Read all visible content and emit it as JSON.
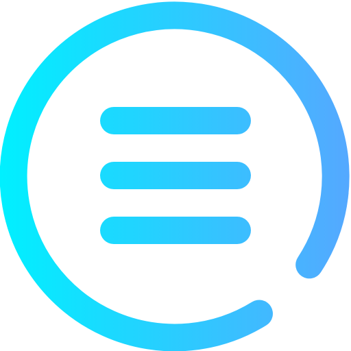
{
  "icon": {
    "name": "menu-circle-icon",
    "gradient_start": "#00F0FF",
    "gradient_end": "#55A8FF",
    "background": "#FFFFFF",
    "menu_lines": 3
  }
}
